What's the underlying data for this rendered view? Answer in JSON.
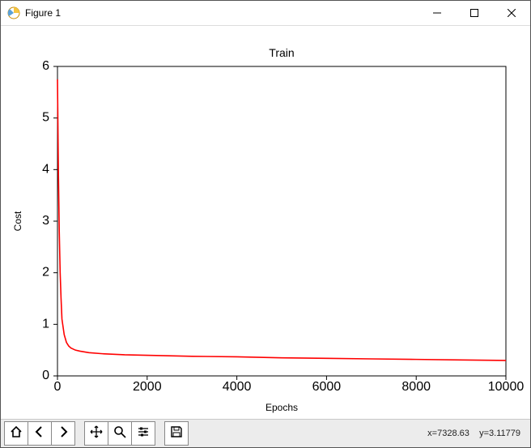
{
  "window": {
    "title": "Figure 1"
  },
  "toolbar": {
    "home": "Home",
    "back": "Back",
    "forward": "Forward",
    "pan": "Pan",
    "zoom": "Zoom",
    "configure": "Configure",
    "save": "Save",
    "coord_x_label": "x=",
    "coord_x": "7328.63",
    "coord_y_label": "y=",
    "coord_y": "3.11779"
  },
  "chart_data": {
    "type": "line",
    "title": "Train",
    "xlabel": "Epochs",
    "ylabel": "Cost",
    "xlim": [
      0,
      10000
    ],
    "ylim": [
      0,
      6
    ],
    "xticks": [
      0,
      2000,
      4000,
      6000,
      8000,
      10000
    ],
    "yticks": [
      0,
      1,
      2,
      3,
      4,
      5,
      6
    ],
    "line_color": "#ff0000",
    "series": [
      {
        "name": "cost",
        "x": [
          0,
          20,
          40,
          60,
          80,
          100,
          150,
          200,
          250,
          300,
          400,
          500,
          700,
          1000,
          1500,
          2000,
          3000,
          4000,
          5000,
          6000,
          7000,
          8000,
          9000,
          10000
        ],
        "y": [
          5.75,
          4.0,
          2.8,
          2.0,
          1.5,
          1.1,
          0.8,
          0.65,
          0.58,
          0.54,
          0.5,
          0.48,
          0.45,
          0.43,
          0.41,
          0.4,
          0.38,
          0.37,
          0.35,
          0.34,
          0.33,
          0.32,
          0.31,
          0.3
        ]
      }
    ]
  }
}
